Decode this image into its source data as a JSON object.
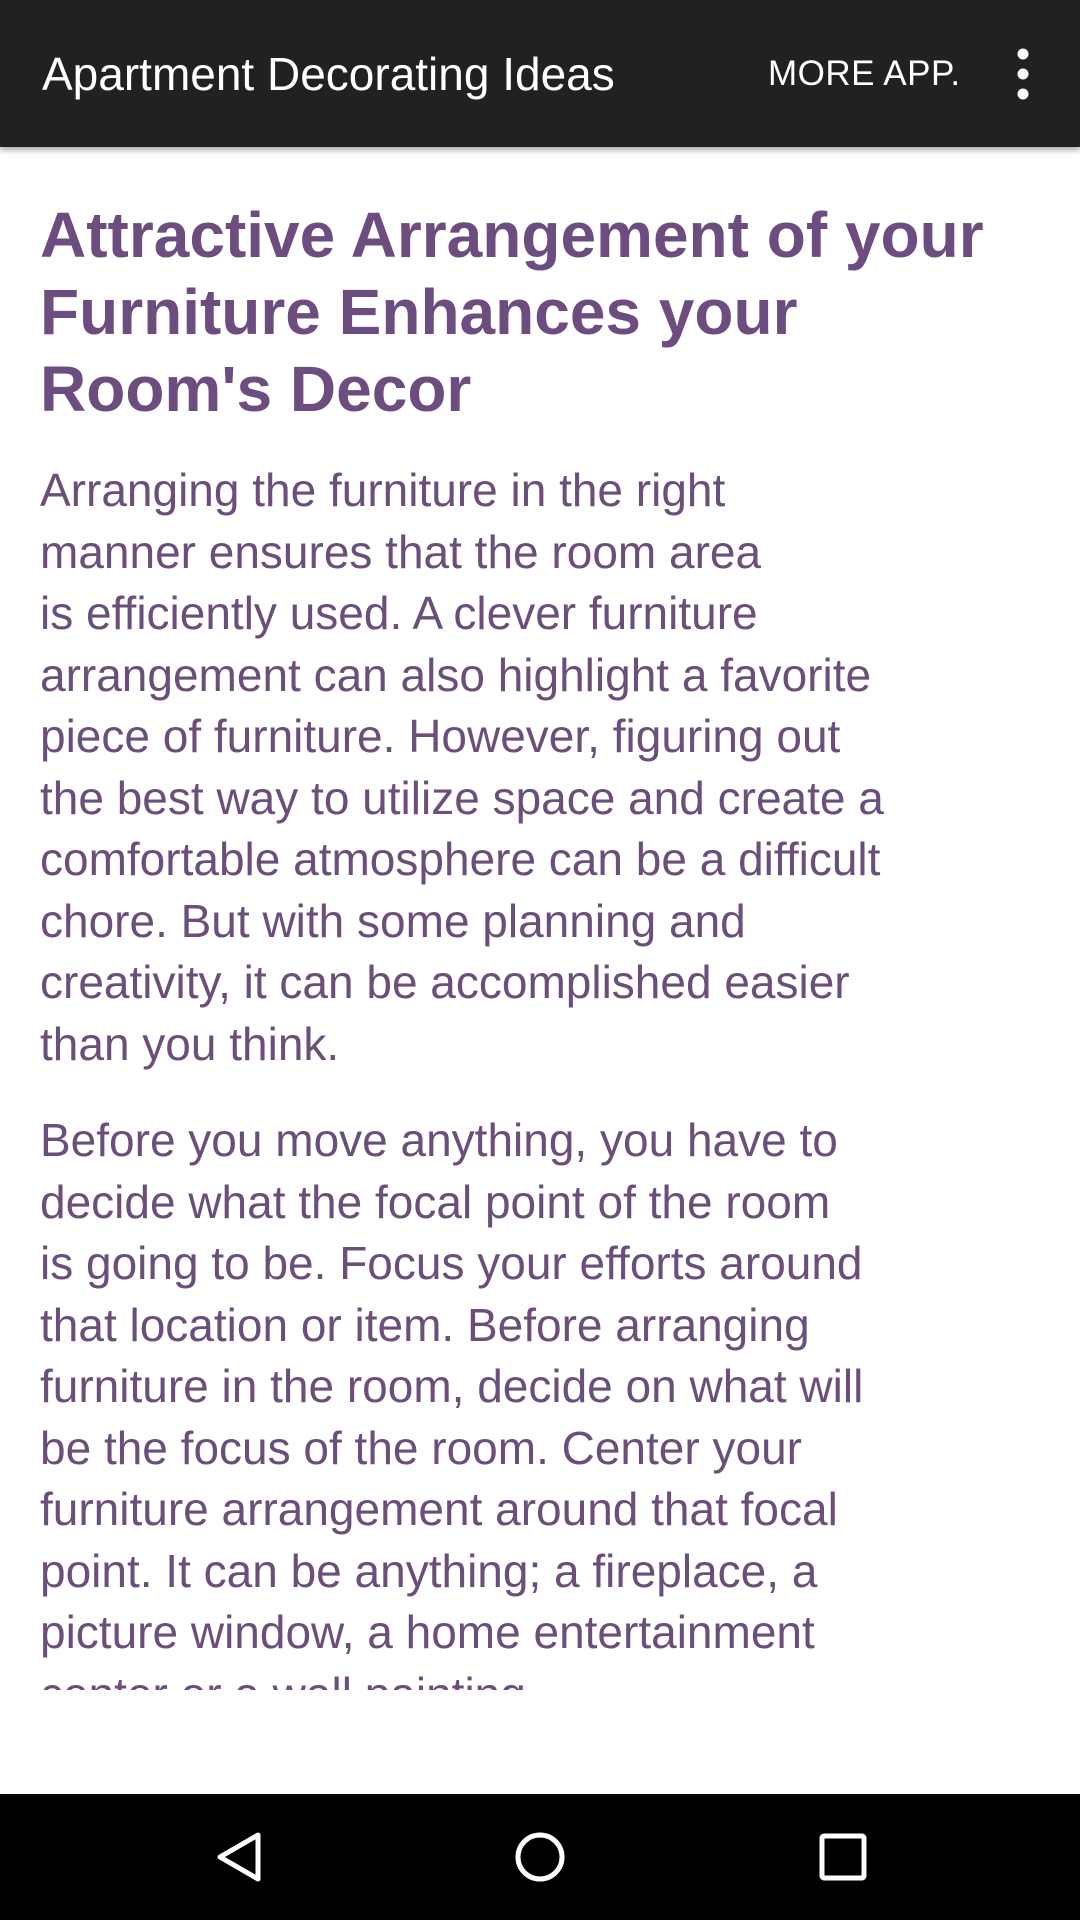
{
  "app_bar": {
    "title": "Apartment Decorating Ideas",
    "more_app_label": "MORE APP.",
    "overflow_icon": "more-vert-icon"
  },
  "article": {
    "title": "Attractive Arrangement of your Furniture Enhances your Room's Decor",
    "paragraphs": [
      "     Arranging the furniture in the right\nmanner ensures that the room area\nis efficiently used.  A clever furniture\narrangement can also highlight a favorite\npiece of furniture.  However, figuring out\nthe best way to utilize space and create a\ncomfortable atmosphere can be a difficult\nchore.  But with some planning and\ncreativity, it can be accomplished easier\nthan you think.",
      "     Before you move anything, you have to\ndecide what the focal point of the room\nis going to be.  Focus your efforts around\nthat location or item.  Before arranging\nfurniture in the room, decide on what will\nbe the focus of the room. Center your\nfurniture arrangement around that focal\npoint.   It can be anything; a fireplace, a\npicture window, a home entertainment\ncenter or a wall painting."
    ]
  },
  "nav_bar": {
    "icons": [
      "back-icon",
      "home-icon",
      "recents-icon"
    ]
  },
  "colors": {
    "app_bar": "#212121",
    "text_purple": "#6b4f7a",
    "background": "#ffffff",
    "nav_bar": "#000000"
  }
}
